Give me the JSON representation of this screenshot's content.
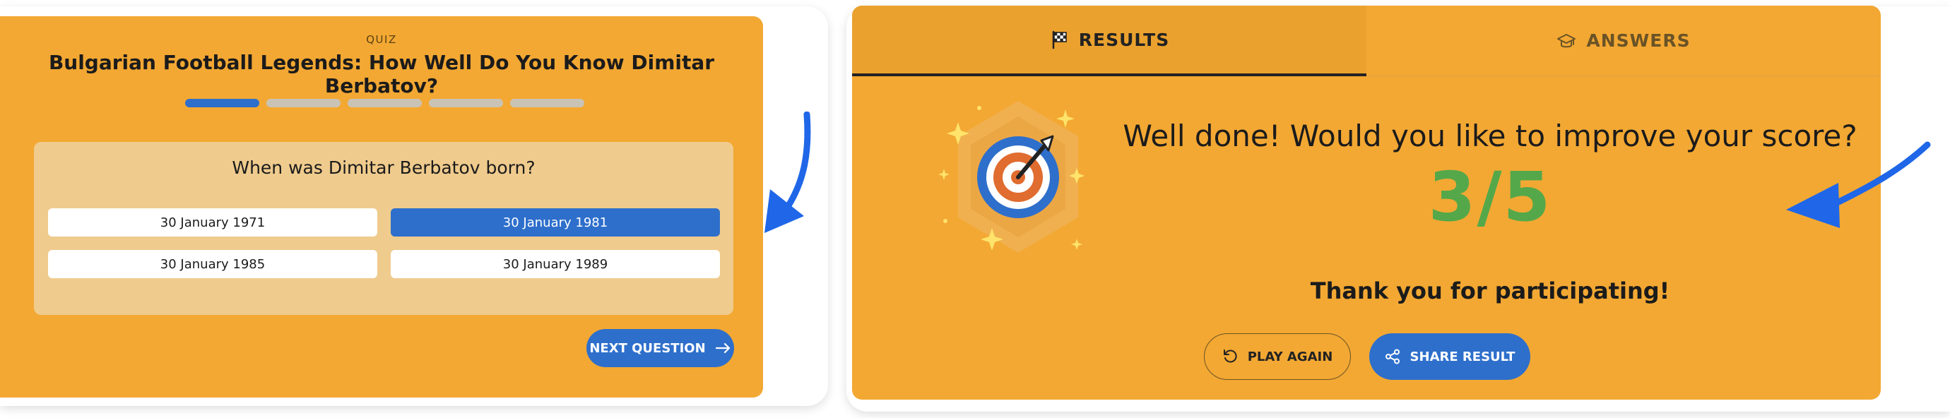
{
  "quiz": {
    "label": "QUIZ",
    "title": "Bulgarian Football Legends: How Well Do You Know Dimitar Berbatov?",
    "progress": {
      "current": 1,
      "total": 5
    },
    "question": "When was Dimitar Berbatov born?",
    "answers": [
      {
        "text": "30 January 1971",
        "selected": false
      },
      {
        "text": "30 January 1981",
        "selected": true
      },
      {
        "text": "30 January 1985",
        "selected": false
      },
      {
        "text": "30 January 1989",
        "selected": false
      }
    ],
    "next_label": "NEXT QUESTION"
  },
  "results": {
    "tabs": [
      {
        "label": "RESULTS",
        "icon": "flag-icon",
        "active": true
      },
      {
        "label": "ANSWERS",
        "icon": "graduation-cap-icon",
        "active": false
      }
    ],
    "badge_icon": "target-dart-icon",
    "heading": "Well done! Would you like to improve your score?",
    "score": "3/5",
    "thanks": "Thank you for participating!",
    "play_again_label": "PLAY AGAIN",
    "share_label": "SHARE RESULT"
  },
  "colors": {
    "panel": "#f3a833",
    "question_box": "#efcb8d",
    "accent_blue": "#2e6fcb",
    "score_green": "#54a84a",
    "annotation_arrow": "#1f67e8"
  }
}
